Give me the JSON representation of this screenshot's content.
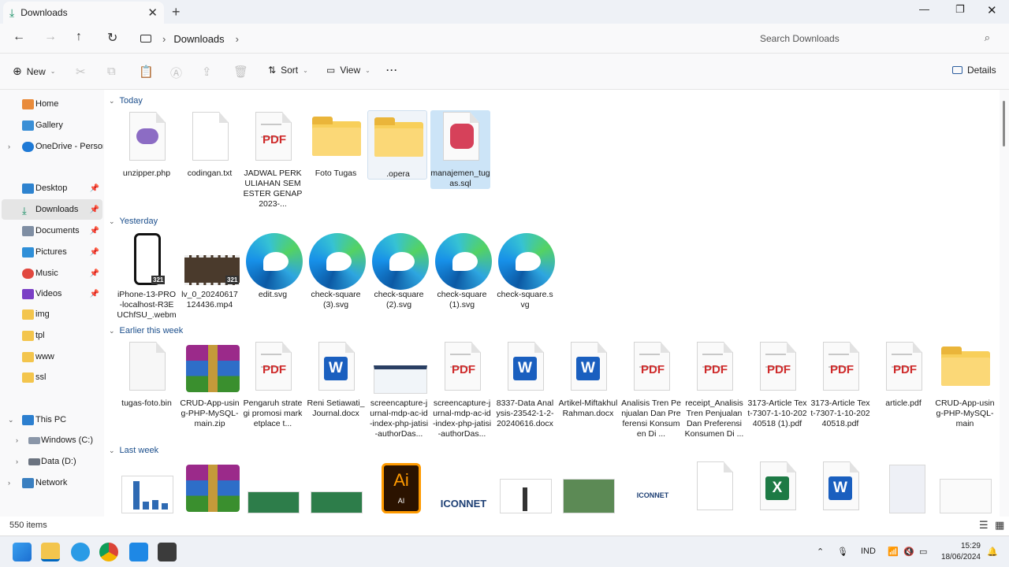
{
  "tab": {
    "title": "Downloads"
  },
  "address": {
    "crumb": "Downloads"
  },
  "search": {
    "placeholder": "Search Downloads"
  },
  "toolbar": {
    "new_label": "New",
    "sort_label": "Sort",
    "view_label": "View",
    "more_label": "···",
    "details_label": "Details"
  },
  "sidebar": {
    "items": [
      {
        "label": "Home"
      },
      {
        "label": "Gallery"
      },
      {
        "label": "OneDrive - Persona"
      },
      {
        "label": "Desktop"
      },
      {
        "label": "Downloads"
      },
      {
        "label": "Documents"
      },
      {
        "label": "Pictures"
      },
      {
        "label": "Music"
      },
      {
        "label": "Videos"
      },
      {
        "label": "img"
      },
      {
        "label": "tpl"
      },
      {
        "label": "www"
      },
      {
        "label": "ssl"
      },
      {
        "label": "This PC"
      },
      {
        "label": "Windows (C:)"
      },
      {
        "label": "Data (D:)"
      },
      {
        "label": "Network"
      }
    ]
  },
  "groups": {
    "today": "Today",
    "yesterday": "Yesterday",
    "earlier": "Earlier this week",
    "lastweek": "Last week"
  },
  "files": {
    "today": [
      "unzipper.php",
      "codingan.txt",
      "JADWAL PERKULIAHAN SEMESTER GENAP 2023-...",
      "Foto Tugas",
      ".opera",
      "manajemen_tugas.sql"
    ],
    "yesterday": [
      "iPhone-13-PRO-localhost-R3EUChfSU_.webm",
      "lv_0_20240617124436.mp4",
      "edit.svg",
      "check-square (3).svg",
      "check-square (2).svg",
      "check-square (1).svg",
      "check-square.svg"
    ],
    "earlier": [
      "tugas-foto.bin",
      "CRUD-App-using-PHP-MySQL-main.zip",
      "Pengaruh strategi promosi marketplace t...",
      "Reni Setiawati_Journal.docx",
      "screencapture-jurnal-mdp-ac-id-index-php-jatisi-authorDas...",
      "screencapture-jurnal-mdp-ac-id-index-php-jatisi-authorDas...",
      "8337-Data Analysis-23542-1-2-20240616.docx",
      "Artikel-Miftakhul Rahman.docx",
      "Analisis Tren Penjualan Dan Preferensi Konsumen Di ...",
      "receipt_Analisis Tren Penjualan Dan Preferensi Konsumen Di ...",
      "3173-Article Text-7307-1-10-20240518 (1).pdf",
      "3173-Article Text-7307-1-10-20240518.pdf",
      "article.pdf",
      "CRUD-App-using-PHP-MySQL-main"
    ]
  },
  "badges": {
    "pdf": "PDF",
    "word": "W",
    "excel": "X",
    "ai": "Ai",
    "ai_sub": "AI",
    "iconnet": "ICONNET",
    "num": "321"
  },
  "status": {
    "count": "550 items"
  },
  "taskbar": {
    "lang": "IND",
    "time": "15:29",
    "date": "18/06/2024"
  },
  "colors": {
    "accent": "#0067c0",
    "selection": "#cce4f7"
  }
}
